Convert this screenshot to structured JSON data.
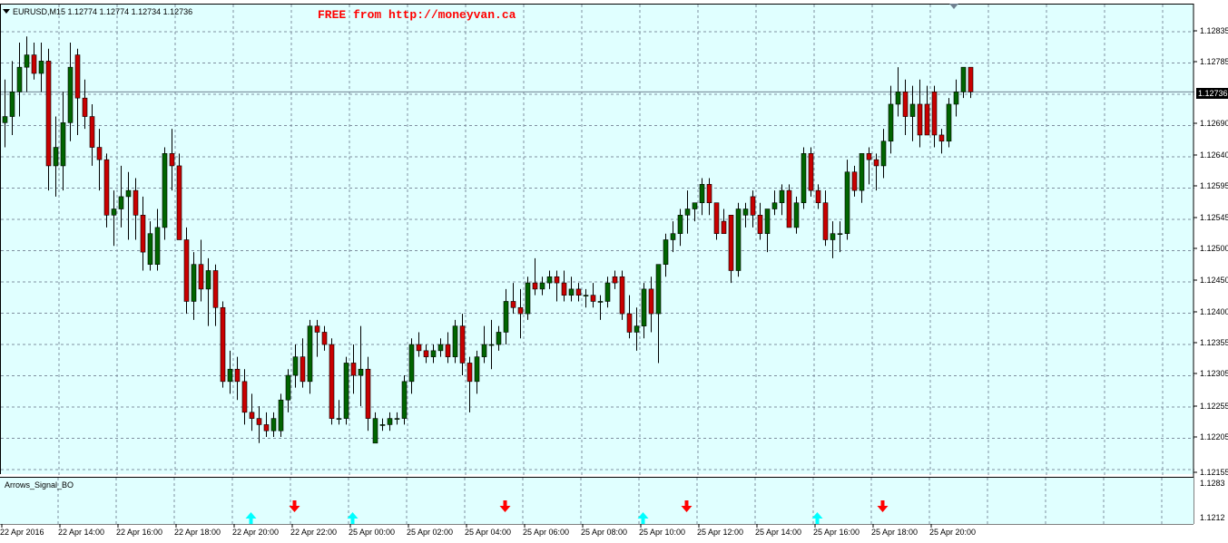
{
  "window": {
    "symbol_line": "EURUSD,M15  1.12774 1.12774 1.12734 1.12736",
    "watermark": "FREE from http://moneyvan.ca",
    "current_price_label": "1.12736",
    "indicator_name": "Arrows_Signal_BO"
  },
  "colors": {
    "background": "#e0ffff",
    "bull": "#006400",
    "bear": "#c80000",
    "grid": "#8090a0",
    "up_arrow": "#00ffff",
    "down_arrow": "#ff0000"
  },
  "price_axis": {
    "labels": [
      "1.12835",
      "1.12785",
      "1.12736",
      "1.12690",
      "1.12640",
      "1.12595",
      "1.12545",
      "1.12500",
      "1.12450",
      "1.12400",
      "1.12355",
      "1.12305",
      "1.12255",
      "1.12205",
      "1.12155"
    ]
  },
  "indicator_axis": {
    "labels": [
      "1.1283",
      "1.1212"
    ]
  },
  "time_axis": {
    "labels": [
      "22 Apr 2016",
      "22 Apr 14:00",
      "22 Apr 16:00",
      "22 Apr 18:00",
      "22 Apr 20:00",
      "22 Apr 22:00",
      "25 Apr 00:00",
      "25 Apr 02:00",
      "25 Apr 04:00",
      "25 Apr 06:00",
      "25 Apr 08:00",
      "25 Apr 10:00",
      "25 Apr 12:00",
      "25 Apr 14:00",
      "25 Apr 16:00",
      "25 Apr 18:00",
      "25 Apr 20:00"
    ]
  },
  "chart_data": {
    "type": "candlestick",
    "price_range": [
      1.1213,
      1.1287
    ],
    "candles": [
      {
        "o": 1.1269,
        "h": 1.1276,
        "l": 1.1265,
        "c": 1.127
      },
      {
        "o": 1.127,
        "h": 1.1279,
        "l": 1.1267,
        "c": 1.1274
      },
      {
        "o": 1.1274,
        "h": 1.1282,
        "l": 1.127,
        "c": 1.1278
      },
      {
        "o": 1.1278,
        "h": 1.1283,
        "l": 1.1274,
        "c": 1.128
      },
      {
        "o": 1.128,
        "h": 1.1282,
        "l": 1.1276,
        "c": 1.1277
      },
      {
        "o": 1.1277,
        "h": 1.1282,
        "l": 1.1274,
        "c": 1.1279
      },
      {
        "o": 1.1279,
        "h": 1.1281,
        "l": 1.1258,
        "c": 1.1262
      },
      {
        "o": 1.1262,
        "h": 1.127,
        "l": 1.1257,
        "c": 1.1265
      },
      {
        "o": 1.1262,
        "h": 1.1274,
        "l": 1.1258,
        "c": 1.1269
      },
      {
        "o": 1.1269,
        "h": 1.1282,
        "l": 1.1266,
        "c": 1.1278
      },
      {
        "o": 1.128,
        "h": 1.1281,
        "l": 1.1267,
        "c": 1.1273
      },
      {
        "o": 1.1273,
        "h": 1.1276,
        "l": 1.1268,
        "c": 1.127
      },
      {
        "o": 1.127,
        "h": 1.1272,
        "l": 1.1262,
        "c": 1.1265
      },
      {
        "o": 1.1265,
        "h": 1.1268,
        "l": 1.1258,
        "c": 1.1263
      },
      {
        "o": 1.1263,
        "h": 1.1264,
        "l": 1.1252,
        "c": 1.1254
      },
      {
        "o": 1.1254,
        "h": 1.1258,
        "l": 1.1249,
        "c": 1.1255
      },
      {
        "o": 1.1255,
        "h": 1.1262,
        "l": 1.1252,
        "c": 1.1257
      },
      {
        "o": 1.1257,
        "h": 1.1261,
        "l": 1.125,
        "c": 1.1258
      },
      {
        "o": 1.1258,
        "h": 1.126,
        "l": 1.125,
        "c": 1.1254
      },
      {
        "o": 1.1254,
        "h": 1.1257,
        "l": 1.1245,
        "c": 1.1248
      },
      {
        "o": 1.1246,
        "h": 1.1253,
        "l": 1.1245,
        "c": 1.1251
      },
      {
        "o": 1.1246,
        "h": 1.1255,
        "l": 1.1245,
        "c": 1.1252
      },
      {
        "o": 1.1252,
        "h": 1.1265,
        "l": 1.125,
        "c": 1.1264
      },
      {
        "o": 1.1264,
        "h": 1.1268,
        "l": 1.1258,
        "c": 1.1262
      },
      {
        "o": 1.1262,
        "h": 1.1264,
        "l": 1.125,
        "c": 1.125
      },
      {
        "o": 1.125,
        "h": 1.1252,
        "l": 1.1238,
        "c": 1.124
      },
      {
        "o": 1.124,
        "h": 1.1248,
        "l": 1.1237,
        "c": 1.1246
      },
      {
        "o": 1.1246,
        "h": 1.125,
        "l": 1.124,
        "c": 1.1242
      },
      {
        "o": 1.1242,
        "h": 1.1247,
        "l": 1.1236,
        "c": 1.1245
      },
      {
        "o": 1.1245,
        "h": 1.1246,
        "l": 1.1236,
        "c": 1.1239
      },
      {
        "o": 1.1239,
        "h": 1.124,
        "l": 1.1226,
        "c": 1.1227
      },
      {
        "o": 1.1227,
        "h": 1.1232,
        "l": 1.1225,
        "c": 1.1229
      },
      {
        "o": 1.1229,
        "h": 1.1231,
        "l": 1.1224,
        "c": 1.1227
      },
      {
        "o": 1.1227,
        "h": 1.1229,
        "l": 1.122,
        "c": 1.1222
      },
      {
        "o": 1.1222,
        "h": 1.1225,
        "l": 1.1219,
        "c": 1.1221
      },
      {
        "o": 1.1221,
        "h": 1.1223,
        "l": 1.1217,
        "c": 1.122
      },
      {
        "o": 1.122,
        "h": 1.1222,
        "l": 1.1218,
        "c": 1.1219
      },
      {
        "o": 1.1219,
        "h": 1.1222,
        "l": 1.1218,
        "c": 1.1221
      },
      {
        "o": 1.1219,
        "h": 1.1225,
        "l": 1.1218,
        "c": 1.1224
      },
      {
        "o": 1.1224,
        "h": 1.1229,
        "l": 1.1222,
        "c": 1.1228
      },
      {
        "o": 1.1228,
        "h": 1.1233,
        "l": 1.1226,
        "c": 1.1231
      },
      {
        "o": 1.1231,
        "h": 1.1234,
        "l": 1.1226,
        "c": 1.1227
      },
      {
        "o": 1.1227,
        "h": 1.1237,
        "l": 1.1225,
        "c": 1.1236
      },
      {
        "o": 1.1236,
        "h": 1.1237,
        "l": 1.1231,
        "c": 1.1235
      },
      {
        "o": 1.1235,
        "h": 1.1236,
        "l": 1.1232,
        "c": 1.1233
      },
      {
        "o": 1.1233,
        "h": 1.1234,
        "l": 1.122,
        "c": 1.1221
      },
      {
        "o": 1.1221,
        "h": 1.1224,
        "l": 1.122,
        "c": 1.1221
      },
      {
        "o": 1.1221,
        "h": 1.1231,
        "l": 1.122,
        "c": 1.123
      },
      {
        "o": 1.123,
        "h": 1.1233,
        "l": 1.1225,
        "c": 1.1228
      },
      {
        "o": 1.1228,
        "h": 1.1236,
        "l": 1.1223,
        "c": 1.1229
      },
      {
        "o": 1.1229,
        "h": 1.1231,
        "l": 1.1219,
        "c": 1.1221
      },
      {
        "o": 1.1217,
        "h": 1.1222,
        "l": 1.1217,
        "c": 1.1221
      },
      {
        "o": 1.122,
        "h": 1.1221,
        "l": 1.1219,
        "c": 1.122
      },
      {
        "o": 1.122,
        "h": 1.1222,
        "l": 1.1219,
        "c": 1.1221
      },
      {
        "o": 1.1221,
        "h": 1.1222,
        "l": 1.122,
        "c": 1.1221
      },
      {
        "o": 1.1221,
        "h": 1.1228,
        "l": 1.122,
        "c": 1.1227
      },
      {
        "o": 1.1227,
        "h": 1.1234,
        "l": 1.1225,
        "c": 1.1233
      },
      {
        "o": 1.1233,
        "h": 1.1235,
        "l": 1.1231,
        "c": 1.1232
      },
      {
        "o": 1.1232,
        "h": 1.1233,
        "l": 1.123,
        "c": 1.1231
      },
      {
        "o": 1.1231,
        "h": 1.1233,
        "l": 1.123,
        "c": 1.1232
      },
      {
        "o": 1.1232,
        "h": 1.1234,
        "l": 1.1231,
        "c": 1.1233
      },
      {
        "o": 1.1233,
        "h": 1.1235,
        "l": 1.123,
        "c": 1.1231
      },
      {
        "o": 1.1231,
        "h": 1.1237,
        "l": 1.123,
        "c": 1.1236
      },
      {
        "o": 1.1236,
        "h": 1.1238,
        "l": 1.1228,
        "c": 1.123
      },
      {
        "o": 1.123,
        "h": 1.1231,
        "l": 1.1222,
        "c": 1.1227
      },
      {
        "o": 1.1227,
        "h": 1.1232,
        "l": 1.1225,
        "c": 1.1231
      },
      {
        "o": 1.1231,
        "h": 1.1236,
        "l": 1.123,
        "c": 1.1233
      },
      {
        "o": 1.1233,
        "h": 1.1237,
        "l": 1.1229,
        "c": 1.1233
      },
      {
        "o": 1.1233,
        "h": 1.1236,
        "l": 1.1232,
        "c": 1.1235
      },
      {
        "o": 1.1235,
        "h": 1.1242,
        "l": 1.1233,
        "c": 1.124
      },
      {
        "o": 1.124,
        "h": 1.1243,
        "l": 1.1238,
        "c": 1.1239
      },
      {
        "o": 1.1239,
        "h": 1.1242,
        "l": 1.1234,
        "c": 1.1238
      },
      {
        "o": 1.1238,
        "h": 1.1244,
        "l": 1.1237,
        "c": 1.1243
      },
      {
        "o": 1.1243,
        "h": 1.1247,
        "l": 1.1241,
        "c": 1.1242
      },
      {
        "o": 1.1242,
        "h": 1.1244,
        "l": 1.1241,
        "c": 1.1243
      },
      {
        "o": 1.1243,
        "h": 1.1245,
        "l": 1.1242,
        "c": 1.1244
      },
      {
        "o": 1.1244,
        "h": 1.1245,
        "l": 1.124,
        "c": 1.1243
      },
      {
        "o": 1.1243,
        "h": 1.1245,
        "l": 1.124,
        "c": 1.1241
      },
      {
        "o": 1.1241,
        "h": 1.1244,
        "l": 1.124,
        "c": 1.1242
      },
      {
        "o": 1.1242,
        "h": 1.1243,
        "l": 1.124,
        "c": 1.1241
      },
      {
        "o": 1.1241,
        "h": 1.1242,
        "l": 1.1239,
        "c": 1.1241
      },
      {
        "o": 1.1241,
        "h": 1.1243,
        "l": 1.1239,
        "c": 1.124
      },
      {
        "o": 1.124,
        "h": 1.1241,
        "l": 1.1237,
        "c": 1.124
      },
      {
        "o": 1.124,
        "h": 1.1244,
        "l": 1.1239,
        "c": 1.1243
      },
      {
        "o": 1.1244,
        "h": 1.1245,
        "l": 1.1242,
        "c": 1.1243
      },
      {
        "o": 1.1244,
        "h": 1.1245,
        "l": 1.1237,
        "c": 1.1238
      },
      {
        "o": 1.1238,
        "h": 1.1241,
        "l": 1.1234,
        "c": 1.1235
      },
      {
        "o": 1.1235,
        "h": 1.1239,
        "l": 1.1232,
        "c": 1.1236
      },
      {
        "o": 1.1236,
        "h": 1.1243,
        "l": 1.1234,
        "c": 1.1242
      },
      {
        "o": 1.1242,
        "h": 1.1244,
        "l": 1.1235,
        "c": 1.1238
      },
      {
        "o": 1.1238,
        "h": 1.1246,
        "l": 1.123,
        "c": 1.1246
      },
      {
        "o": 1.1246,
        "h": 1.1251,
        "l": 1.1244,
        "c": 1.125
      },
      {
        "o": 1.125,
        "h": 1.1253,
        "l": 1.1248,
        "c": 1.1251
      },
      {
        "o": 1.1251,
        "h": 1.1255,
        "l": 1.1249,
        "c": 1.1254
      },
      {
        "o": 1.1254,
        "h": 1.1258,
        "l": 1.1251,
        "c": 1.1255
      },
      {
        "o": 1.1255,
        "h": 1.1256,
        "l": 1.1253,
        "c": 1.1256
      },
      {
        "o": 1.1256,
        "h": 1.126,
        "l": 1.1254,
        "c": 1.1259
      },
      {
        "o": 1.1259,
        "h": 1.126,
        "l": 1.1254,
        "c": 1.1256
      },
      {
        "o": 1.1256,
        "h": 1.1256,
        "l": 1.125,
        "c": 1.1251
      },
      {
        "o": 1.1253,
        "h": 1.1255,
        "l": 1.1251,
        "c": 1.1251
      },
      {
        "o": 1.1254,
        "h": 1.1254,
        "l": 1.1243,
        "c": 1.1245
      },
      {
        "o": 1.1245,
        "h": 1.1256,
        "l": 1.1244,
        "c": 1.1255
      },
      {
        "o": 1.1254,
        "h": 1.1256,
        "l": 1.1252,
        "c": 1.1255
      },
      {
        "o": 1.1257,
        "h": 1.1258,
        "l": 1.1252,
        "c": 1.1254
      },
      {
        "o": 1.1254,
        "h": 1.1256,
        "l": 1.125,
        "c": 1.1251
      },
      {
        "o": 1.1251,
        "h": 1.1255,
        "l": 1.1248,
        "c": 1.1255
      },
      {
        "o": 1.1255,
        "h": 1.1258,
        "l": 1.1254,
        "c": 1.1256
      },
      {
        "o": 1.1256,
        "h": 1.1259,
        "l": 1.1254,
        "c": 1.1258
      },
      {
        "o": 1.1258,
        "h": 1.1259,
        "l": 1.1252,
        "c": 1.1252
      },
      {
        "o": 1.1252,
        "h": 1.1257,
        "l": 1.1251,
        "c": 1.1256
      },
      {
        "o": 1.1256,
        "h": 1.1265,
        "l": 1.1255,
        "c": 1.1264
      },
      {
        "o": 1.1264,
        "h": 1.1265,
        "l": 1.1257,
        "c": 1.1258
      },
      {
        "o": 1.1258,
        "h": 1.1259,
        "l": 1.1255,
        "c": 1.1256
      },
      {
        "o": 1.1256,
        "h": 1.1258,
        "l": 1.1249,
        "c": 1.125
      },
      {
        "o": 1.125,
        "h": 1.1253,
        "l": 1.1247,
        "c": 1.1251
      },
      {
        "o": 1.1251,
        "h": 1.1253,
        "l": 1.1248,
        "c": 1.1251
      },
      {
        "o": 1.1251,
        "h": 1.1263,
        "l": 1.125,
        "c": 1.1261
      },
      {
        "o": 1.1261,
        "h": 1.1262,
        "l": 1.1257,
        "c": 1.1258
      },
      {
        "o": 1.1258,
        "h": 1.1264,
        "l": 1.1256,
        "c": 1.1264
      },
      {
        "o": 1.1264,
        "h": 1.1265,
        "l": 1.1259,
        "c": 1.1263
      },
      {
        "o": 1.1263,
        "h": 1.1264,
        "l": 1.1258,
        "c": 1.1262
      },
      {
        "o": 1.1262,
        "h": 1.1268,
        "l": 1.126,
        "c": 1.1266
      },
      {
        "o": 1.1266,
        "h": 1.1275,
        "l": 1.1264,
        "c": 1.1272
      },
      {
        "o": 1.1272,
        "h": 1.1278,
        "l": 1.127,
        "c": 1.1274
      },
      {
        "o": 1.1274,
        "h": 1.1276,
        "l": 1.1267,
        "c": 1.127
      },
      {
        "o": 1.127,
        "h": 1.1275,
        "l": 1.1266,
        "c": 1.1272
      },
      {
        "o": 1.1272,
        "h": 1.1276,
        "l": 1.1265,
        "c": 1.1267
      },
      {
        "o": 1.1272,
        "h": 1.1275,
        "l": 1.1267,
        "c": 1.1267
      },
      {
        "o": 1.1274,
        "h": 1.1275,
        "l": 1.1265,
        "c": 1.1267
      },
      {
        "o": 1.1267,
        "h": 1.1268,
        "l": 1.1264,
        "c": 1.1266
      },
      {
        "o": 1.1266,
        "h": 1.1273,
        "l": 1.1265,
        "c": 1.1272
      },
      {
        "o": 1.1272,
        "h": 1.1276,
        "l": 1.127,
        "c": 1.1274
      },
      {
        "o": 1.1274,
        "h": 1.1278,
        "l": 1.1273,
        "c": 1.1278
      },
      {
        "o": 1.1278,
        "h": 1.1278,
        "l": 1.1273,
        "c": 1.1274
      }
    ],
    "signals": [
      {
        "dir": "up",
        "bar": 34
      },
      {
        "dir": "down",
        "bar": 40
      },
      {
        "dir": "up",
        "bar": 48
      },
      {
        "dir": "down",
        "bar": 69
      },
      {
        "dir": "up",
        "bar": 88
      },
      {
        "dir": "down",
        "bar": 94
      },
      {
        "dir": "up",
        "bar": 112
      },
      {
        "dir": "down",
        "bar": 121
      }
    ]
  }
}
